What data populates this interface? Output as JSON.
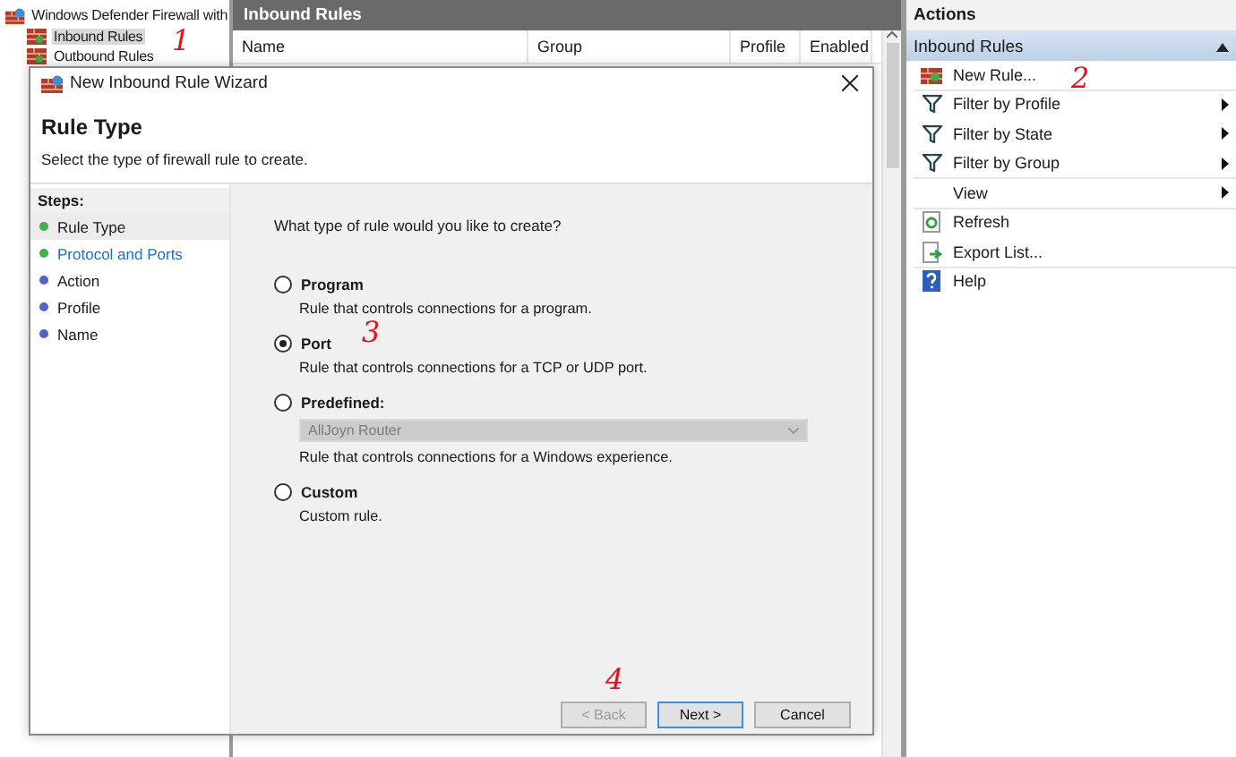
{
  "tree": {
    "items": [
      {
        "label": "Windows Defender Firewall with",
        "selected": false,
        "children": [
          {
            "label": "Inbound Rules",
            "selected": true
          },
          {
            "label": "Outbound Rules",
            "selected": false
          }
        ]
      }
    ]
  },
  "list_pane": {
    "title": "Inbound Rules",
    "columns": [
      "Name",
      "Group",
      "Profile",
      "Enabled"
    ]
  },
  "actions": {
    "title": "Actions",
    "section": {
      "title": "Inbound Rules",
      "expanded": true,
      "items": [
        {
          "label": "New Rule...",
          "kind": "new-rule",
          "submenu": false,
          "divider": true
        },
        {
          "label": "Filter by Profile",
          "kind": "filter",
          "submenu": true,
          "divider": false
        },
        {
          "label": "Filter by State",
          "kind": "filter",
          "submenu": true,
          "divider": false
        },
        {
          "label": "Filter by Group",
          "kind": "filter",
          "submenu": true,
          "divider": true
        },
        {
          "label": "View",
          "kind": "plain",
          "submenu": true,
          "divider": true
        },
        {
          "label": "Refresh",
          "kind": "refresh",
          "submenu": false,
          "divider": false
        },
        {
          "label": "Export List...",
          "kind": "export",
          "submenu": false,
          "divider": true
        },
        {
          "label": "Help",
          "kind": "help",
          "submenu": false,
          "divider": false
        }
      ]
    }
  },
  "wizard": {
    "title": "New Inbound Rule Wizard",
    "heading": "Rule Type",
    "subtitle": "Select the type of firewall rule to create.",
    "steps_title": "Steps:",
    "steps": [
      {
        "label": "Rule Type",
        "selected": true,
        "completed": true,
        "link": false
      },
      {
        "label": "Protocol and Ports",
        "selected": false,
        "completed": true,
        "link": true
      },
      {
        "label": "Action",
        "selected": false,
        "completed": false,
        "link": false
      },
      {
        "label": "Profile",
        "selected": false,
        "completed": false,
        "link": false
      },
      {
        "label": "Name",
        "selected": false,
        "completed": false,
        "link": false
      }
    ],
    "question": "What type of rule would you like to create?",
    "options": [
      {
        "label": "Program",
        "description": "Rule that controls connections for a program.",
        "selected": false
      },
      {
        "label": "Port",
        "description": "Rule that controls connections for a TCP or UDP port.",
        "selected": true
      },
      {
        "label": "Predefined:",
        "description": "Rule that controls connections for a Windows experience.",
        "selected": false,
        "dropdown": {
          "value": "AllJoyn Router",
          "disabled": true
        }
      },
      {
        "label": "Custom",
        "description": "Custom rule.",
        "selected": false
      }
    ],
    "buttons": [
      {
        "label": "< Back",
        "disabled": true,
        "default": false
      },
      {
        "label": "Next >",
        "disabled": false,
        "default": true
      },
      {
        "label": "Cancel",
        "disabled": false,
        "default": false
      }
    ]
  },
  "annotations": [
    {
      "text": "1",
      "color": "#e8101a"
    },
    {
      "text": "2",
      "color": "#e8101a"
    },
    {
      "text": "3",
      "color": "#e8101a"
    },
    {
      "text": "4",
      "color": "#e8101a"
    }
  ]
}
